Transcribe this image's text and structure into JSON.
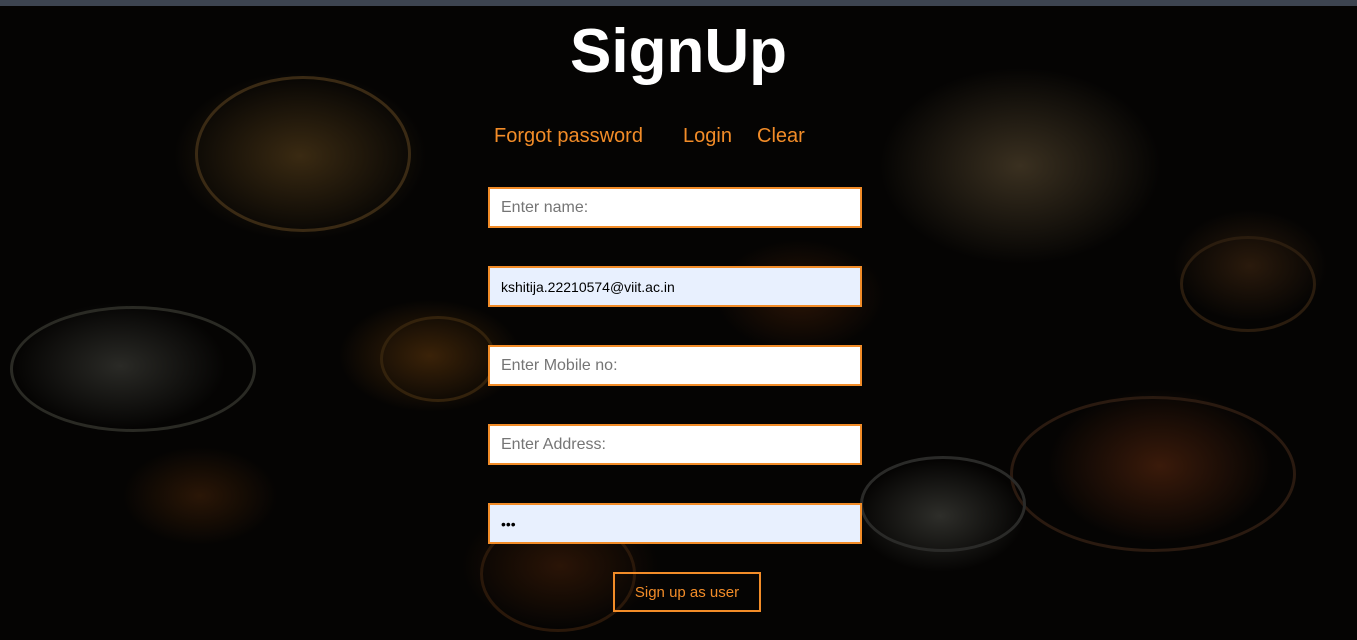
{
  "page": {
    "title": "SignUp"
  },
  "nav": {
    "forgot_password": "Forgot password",
    "login": "Login",
    "clear": "Clear"
  },
  "form": {
    "name": {
      "placeholder": "Enter name:",
      "value": ""
    },
    "email": {
      "placeholder": "",
      "value": "kshitija.22210574@viit.ac.in"
    },
    "mobile": {
      "placeholder": "Enter Mobile no:",
      "value": ""
    },
    "address": {
      "placeholder": "Enter Address:",
      "value": ""
    },
    "password": {
      "placeholder": "",
      "value": "abc"
    },
    "submit_label": "Sign up as user"
  },
  "colors": {
    "accent": "#f28c28",
    "title": "#ffffff",
    "autofill_bg": "#e8f0fe",
    "topbar": "#3d4450"
  }
}
